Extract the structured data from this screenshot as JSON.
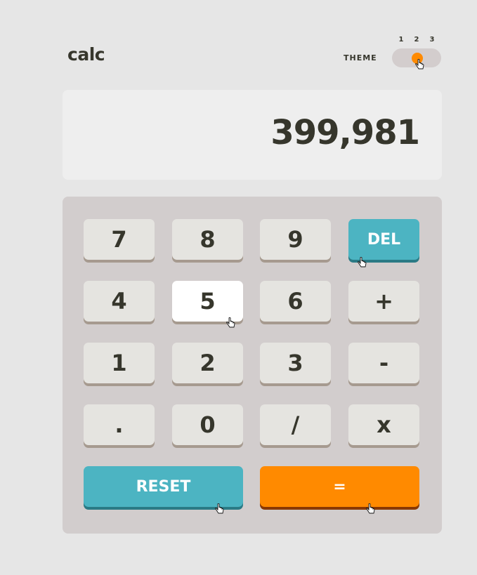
{
  "header": {
    "logo": "calc",
    "theme_label": "THEME",
    "theme_options": [
      "1",
      "2",
      "3"
    ],
    "theme_selected": "2"
  },
  "display": {
    "value": "399,981"
  },
  "keys": {
    "k7": "7",
    "k8": "8",
    "k9": "9",
    "del": "DEL",
    "k4": "4",
    "k5": "5",
    "k6": "6",
    "plus": "+",
    "k1": "1",
    "k2": "2",
    "k3": "3",
    "minus": "-",
    "dot": ".",
    "k0": "0",
    "slash": "/",
    "times": "x",
    "reset": "RESET",
    "equals": "="
  },
  "colors": {
    "background": "#e6e6e6",
    "display_bg": "#eeeeee",
    "keypad_bg": "#d2cdcd",
    "key_bg": "#e5e4e0",
    "key_shadow": "#a69a8f",
    "accent_blue": "#4cb4c2",
    "accent_orange": "#ff8a00",
    "text": "#36362c"
  }
}
